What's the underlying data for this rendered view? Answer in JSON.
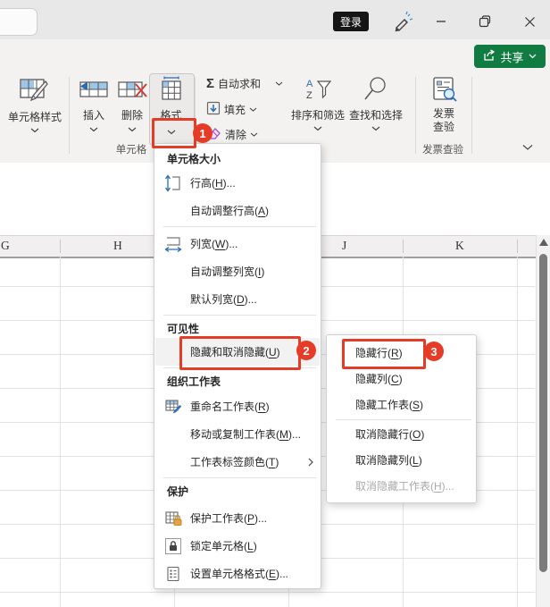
{
  "titlebar": {
    "login_label": "登录"
  },
  "share": {
    "label": "共享"
  },
  "ribbon": {
    "cell_styles_label": "单元格样式",
    "insert_label": "插入",
    "delete_label": "删除",
    "format_label": "格式",
    "autosum_label": "自动求和",
    "fill_label": "填充",
    "clear_label": "清除",
    "sort_filter_label": "排序和筛选",
    "find_select_label": "查找和选择",
    "invoice_label_line1": "发票",
    "invoice_label_line2": "查验",
    "group_cells_label": "单元格",
    "group_invoice_label": "发票查验"
  },
  "format_menu": {
    "items": [
      {
        "type": "header",
        "label": "单元格大小"
      },
      {
        "type": "item",
        "icon": "row-height-icon",
        "pre": "行高(",
        "key": "H",
        "post": ")..."
      },
      {
        "type": "item",
        "pre": "自动调整行高(",
        "key": "A",
        "post": ")"
      },
      {
        "type": "item",
        "icon": "column-width-icon",
        "pre": "列宽(",
        "key": "W",
        "post": ")..."
      },
      {
        "type": "item",
        "pre": "自动调整列宽(",
        "key": "I",
        "post": ")"
      },
      {
        "type": "item",
        "pre": "默认列宽(",
        "key": "D",
        "post": ")..."
      },
      {
        "type": "header",
        "label": "可见性"
      },
      {
        "type": "item",
        "pre": "隐藏和取消隐藏(",
        "key": "U",
        "post": ")",
        "submenu": true,
        "highlighted": true
      },
      {
        "type": "header",
        "label": "组织工作表"
      },
      {
        "type": "item",
        "icon": "rename-sheet-icon",
        "pre": "重命名工作表(",
        "key": "R",
        "post": ")"
      },
      {
        "type": "item",
        "pre": "移动或复制工作表(",
        "key": "M",
        "post": ")..."
      },
      {
        "type": "item",
        "pre": "工作表标签颜色(",
        "key": "T",
        "post": ")",
        "submenu": true
      },
      {
        "type": "header",
        "label": "保护"
      },
      {
        "type": "item",
        "icon": "protect-sheet-icon",
        "pre": "保护工作表(",
        "key": "P",
        "post": ")..."
      },
      {
        "type": "item",
        "icon": "lock-cell-icon",
        "pre": "锁定单元格(",
        "key": "L",
        "post": ")"
      },
      {
        "type": "item",
        "icon": "format-cells-icon",
        "pre": "设置单元格格式(",
        "key": "E",
        "post": ")..."
      }
    ]
  },
  "hide_submenu": {
    "items": [
      {
        "pre": "隐藏行(",
        "key": "R",
        "post": ")",
        "highlighted": true
      },
      {
        "pre": "隐藏列(",
        "key": "C",
        "post": ")"
      },
      {
        "pre": "隐藏工作表(",
        "key": "S",
        "post": ")"
      },
      {
        "pre": "取消隐藏行(",
        "key": "O",
        "post": ")"
      },
      {
        "pre": "取消隐藏列(",
        "key": "L",
        "post": ")"
      },
      {
        "pre": "取消隐藏工作表(",
        "key": "H",
        "post": ")...",
        "disabled": true
      }
    ]
  },
  "annotations": {
    "step1": "1",
    "step2": "2",
    "step3": "3"
  },
  "sheet": {
    "column_headers": [
      "G",
      "H",
      "J",
      "K"
    ]
  },
  "colors": {
    "accent_green": "#107c41",
    "annotation_red": "#e53c28",
    "icon_blue": "#2b6cb5"
  }
}
